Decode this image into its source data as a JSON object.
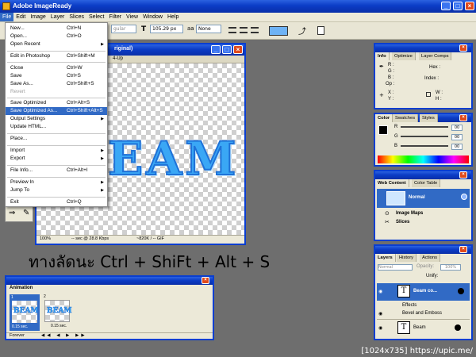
{
  "window": {
    "title": "Adobe ImageReady"
  },
  "menubar": [
    "File",
    "Edit",
    "Image",
    "Layer",
    "Slices",
    "Select",
    "Filter",
    "View",
    "Window",
    "Help"
  ],
  "toolbar": {
    "font_size": "105.29 px",
    "antialias": "None",
    "font_style": "gular"
  },
  "file_menu": {
    "items": [
      {
        "label": "New...",
        "shortcut": "Ctrl+N"
      },
      {
        "label": "Open...",
        "shortcut": "Ctrl+O"
      },
      {
        "label": "Open Recent",
        "shortcut": "",
        "submenu": true
      },
      {
        "label": "Edit in Photoshop",
        "shortcut": "Ctrl+Shift+M"
      },
      {
        "label": "Close",
        "shortcut": "Ctrl+W"
      },
      {
        "label": "Save",
        "shortcut": "Ctrl+S"
      },
      {
        "label": "Save As...",
        "shortcut": "Ctrl+Shift+S"
      },
      {
        "label": "Revert",
        "shortcut": "",
        "disabled": true
      },
      {
        "label": "Save Optimized",
        "shortcut": "Ctrl+Alt+S"
      },
      {
        "label": "Save Optimized As...",
        "shortcut": "Ctrl+Shift+Alt+S",
        "highlighted": true
      },
      {
        "label": "Output Settings",
        "shortcut": "",
        "submenu": true
      },
      {
        "label": "Update HTML...",
        "shortcut": ""
      },
      {
        "label": "Place...",
        "shortcut": ""
      },
      {
        "label": "Import",
        "shortcut": "",
        "submenu": true
      },
      {
        "label": "Export",
        "shortcut": "",
        "submenu": true
      },
      {
        "label": "File Info...",
        "shortcut": "Ctrl+Alt+I"
      },
      {
        "label": "Preview In",
        "shortcut": "",
        "submenu": true
      },
      {
        "label": "Jump To",
        "shortcut": "",
        "submenu": true
      },
      {
        "label": "Exit",
        "shortcut": "Ctrl+Q"
      }
    ]
  },
  "document": {
    "title_partial": "riginal)",
    "tab": "4-Up",
    "artwork_text": "EAM",
    "status_zoom": "100%",
    "status_speed": "-- sec @ 28.8 Kbps",
    "status_size": "~820K / -- GIF"
  },
  "caption": "ทางลัดนะ Ctrl + ShiFt + Alt + S",
  "info_panel": {
    "tabs": [
      "Info",
      "Optimize",
      "Layer Comps"
    ],
    "labels": [
      "R :",
      "G :",
      "B :",
      "Op :",
      "Hex :",
      "Index :",
      "X :",
      "Y :",
      "W :",
      "H :"
    ]
  },
  "color_panel": {
    "tabs": [
      "Color",
      "Swatches",
      "Styles"
    ],
    "channels": [
      {
        "name": "R",
        "value": "00"
      },
      {
        "name": "G",
        "value": "00"
      },
      {
        "name": "B",
        "value": "00"
      }
    ]
  },
  "web_panel": {
    "tabs": [
      "Web Content",
      "Color Table"
    ],
    "items": [
      "Normal",
      "Image Maps",
      "Slices"
    ]
  },
  "layers_panel": {
    "tabs": [
      "Layers",
      "History",
      "Actions"
    ],
    "blend": "Normal",
    "opacity_label": "Opacity:",
    "opacity": "100%",
    "unify_label": "Unify:",
    "layers": [
      {
        "name": "Beam co...",
        "selected": true
      },
      {
        "name": "Effects",
        "indent": true
      },
      {
        "name": "Bevel and Emboss",
        "indent": true
      },
      {
        "name": "Beam",
        "selected": false
      }
    ]
  },
  "animation_panel": {
    "title": "Animation",
    "frames": [
      {
        "number": "1",
        "delay": "0.15 sec."
      },
      {
        "number": "2",
        "delay": "0.15 sec."
      }
    ],
    "loop": "Forever"
  },
  "watermark": "[1024x735] https://upic.me/",
  "colors": {
    "title_blue": "#0a3ed0",
    "menu_highlight": "#316ac5",
    "artwork_blue": "#3aa7f5"
  }
}
